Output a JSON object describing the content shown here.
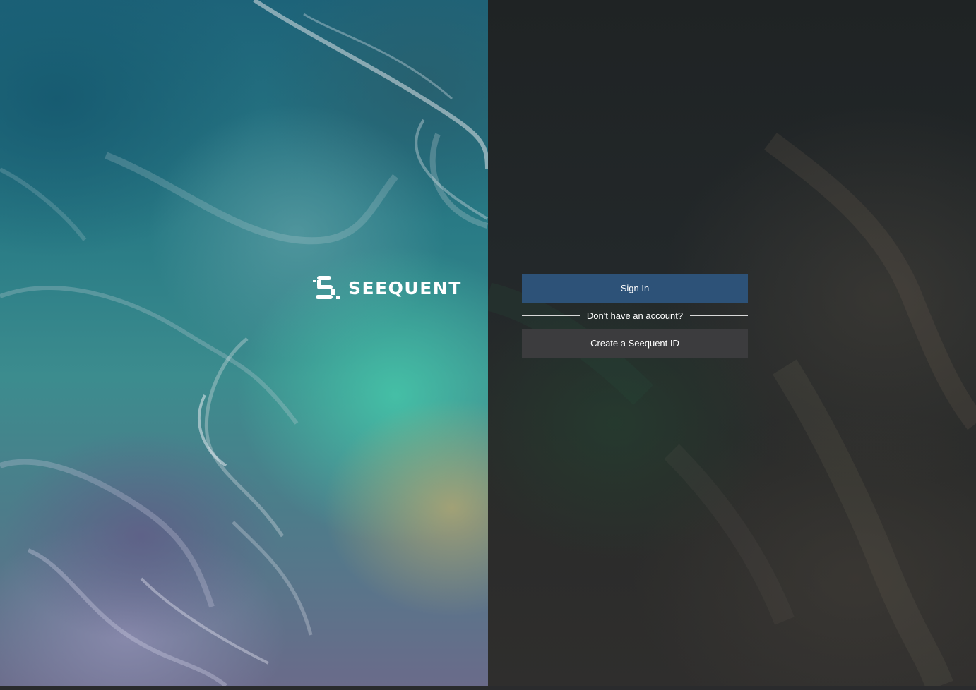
{
  "brand": {
    "name": "SEEQUENT",
    "logo_icon": "seequent-logo-icon"
  },
  "auth": {
    "sign_in_label": "Sign In",
    "divider_text": "Don't have an account?",
    "create_account_label": "Create a Seequent ID"
  },
  "colors": {
    "primary_button": "#2d5278",
    "secondary_button": "#3c3c3e",
    "text": "#ffffff"
  }
}
